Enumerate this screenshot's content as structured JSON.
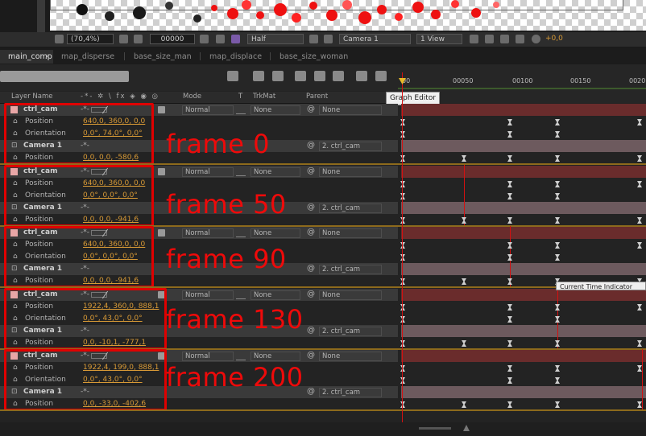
{
  "viewer": {
    "zoom": "(70,4%)",
    "timecode": "00000",
    "resolution": "Half",
    "camera": "Camera 1",
    "view": "1 View",
    "exposure": "+0,0"
  },
  "tabs": [
    {
      "label": "main_comp"
    },
    {
      "label": "map_disperse"
    },
    {
      "label": "base_size_man"
    },
    {
      "label": "map_displace"
    },
    {
      "label": "base_size_woman"
    }
  ],
  "header": {
    "layer_name": "Layer Name",
    "mode": "Mode",
    "t": "T",
    "trkmat": "TrkMat",
    "parent": "Parent"
  },
  "ruler": {
    "ticks": [
      "00",
      "00050",
      "00100",
      "00150",
      "0020"
    ]
  },
  "tooltip": "Graph Editor",
  "cti_tooltip": "Current Time Indicator",
  "blocks": [
    {
      "frame_label": "frame 0",
      "ctrl_name": "ctrl_cam",
      "mode": "Normal",
      "trkmat": "None",
      "parent_none": "None",
      "position_label": "Position",
      "position_value": "640,0, 360,0, 0,0",
      "orientation_label": "Orientation",
      "orientation_value": "0,0°, 74,0°, 0,0°",
      "camera_name": "Camera 1",
      "camera_parent": "2. ctrl_cam",
      "cam_position_label": "Position",
      "cam_position_value": "0,0, 0,0, -580,6"
    },
    {
      "frame_label": "frame 50",
      "ctrl_name": "ctrl_cam",
      "mode": "Normal",
      "trkmat": "None",
      "parent_none": "None",
      "position_label": "Position",
      "position_value": "640,0, 360,0, 0,0",
      "orientation_label": "Orientation",
      "orientation_value": "0,0°, 0,0°, 0,0°",
      "camera_name": "Camera 1",
      "camera_parent": "2. ctrl_cam",
      "cam_position_label": "Position",
      "cam_position_value": "0,0, 0,0, -941,6"
    },
    {
      "frame_label": "frame 90",
      "ctrl_name": "ctrl_cam",
      "mode": "Normal",
      "trkmat": "None",
      "parent_none": "None",
      "position_label": "Position",
      "position_value": "640,0, 360,0, 0,0",
      "orientation_label": "Orientation",
      "orientation_value": "0,0°, 0,0°, 0,0°",
      "camera_name": "Camera 1",
      "camera_parent": "2. ctrl_cam",
      "cam_position_label": "Position",
      "cam_position_value": "0,0, 0,0, -941,6"
    },
    {
      "frame_label": "frame 130",
      "ctrl_name": "ctrl_cam",
      "mode": "Normal",
      "trkmat": "None",
      "parent_none": "None",
      "position_label": "Position",
      "position_value": "1922,4, 360,0, 888,1",
      "orientation_label": "Orientation",
      "orientation_value": "0,0°, 43,0°, 0,0°",
      "camera_name": "Camera 1",
      "camera_parent": "2. ctrl_cam",
      "cam_position_label": "Position",
      "cam_position_value": "0,0, -10,1, -777,1"
    },
    {
      "frame_label": "frame 200",
      "ctrl_name": "ctrl_cam",
      "mode": "Normal",
      "trkmat": "None",
      "parent_none": "None",
      "position_label": "Position",
      "position_value": "1922,4, 199,0, 888,1",
      "orientation_label": "Orientation",
      "orientation_value": "0,0°, 43,0°, 0,0°",
      "camera_name": "Camera 1",
      "camera_parent": "2. ctrl_cam",
      "cam_position_label": "Position",
      "cam_position_value": "0,0, -33,0, -402,6"
    }
  ],
  "colors": {
    "annotation_red": "#e00000",
    "keyframe_value_orange": "#d89a36",
    "cti_red": "#d41111"
  }
}
